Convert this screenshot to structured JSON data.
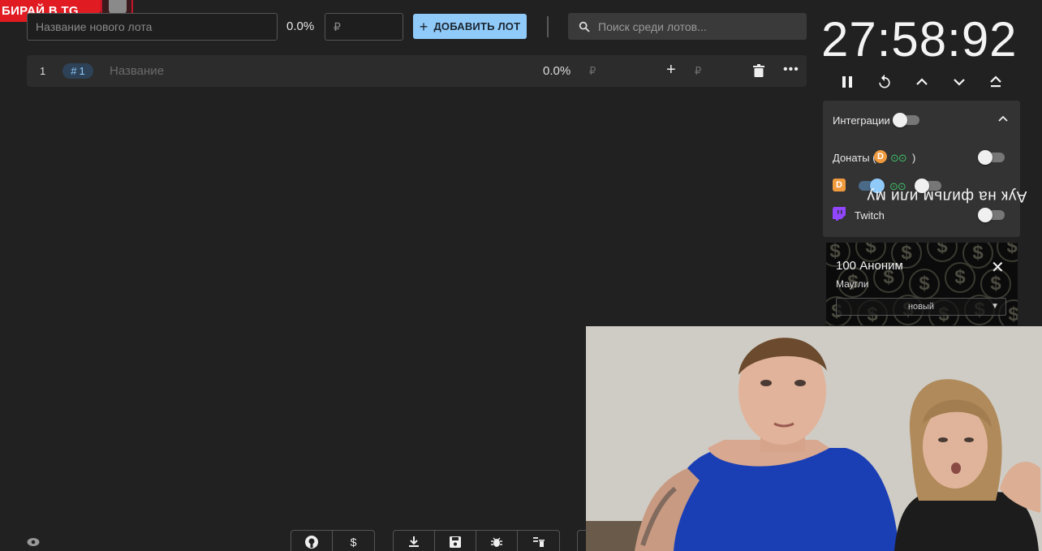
{
  "banner": {
    "text": "БИРАЙ В TG"
  },
  "new_lot": {
    "placeholder": "Название нового лота",
    "percent": "0.0%",
    "price_placeholder": "₽",
    "add_label": "ДОБАВИТЬ ЛОТ"
  },
  "search": {
    "placeholder": "Поиск среди лотов..."
  },
  "lots": [
    {
      "index": "1",
      "tag": "1",
      "name": "Название",
      "percent": "0.0%",
      "currency": "₽",
      "add_currency": "₽"
    }
  ],
  "timer": {
    "value": "27:58:92"
  },
  "integrations": {
    "title": "Интеграции",
    "donations_label": "Донаты (",
    "donations_close": ")",
    "twitch_label": "Twitch",
    "overlay_text": "Аук на фильм или му"
  },
  "donation": {
    "amount": "100 Аноним",
    "name": "Маугли",
    "select_value": "новый"
  },
  "colors": {
    "accent": "#90caf9",
    "banner_red": "#e01b22",
    "donate_orange": "#f09a3e",
    "twitch_purple": "#9146ff"
  }
}
